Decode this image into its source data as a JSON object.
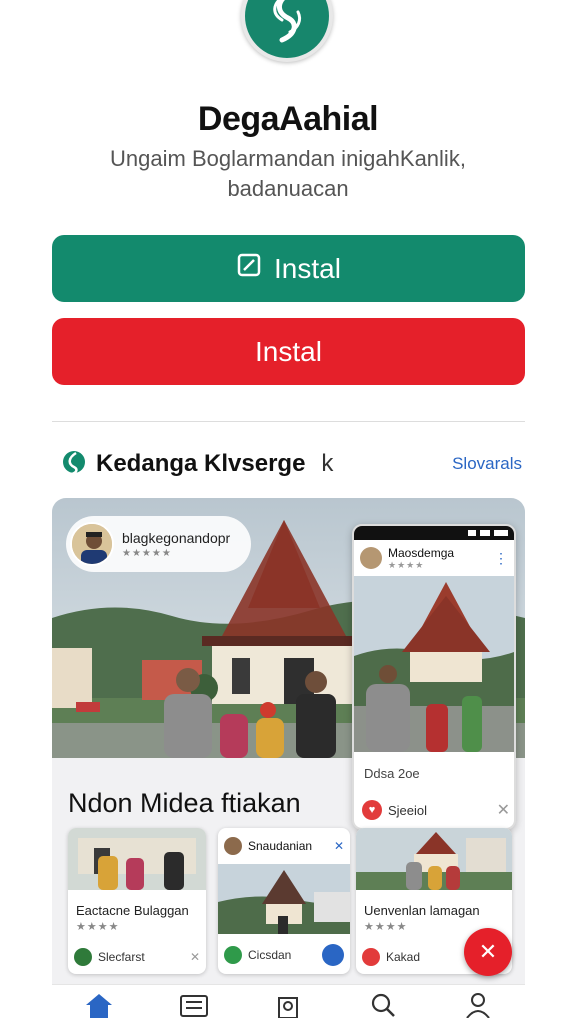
{
  "header": {
    "app_title": "DegaAahial",
    "subtitle_line1": "Ungaim Boglarmandan inigahKanlik,",
    "subtitle_line2": "badanuacan"
  },
  "buttons": {
    "primary_label": "Instal",
    "secondary_label": "Instal"
  },
  "section": {
    "title": "Kedanga Klvserge",
    "mark": "k",
    "link": "Slovarals"
  },
  "gallery": {
    "badge_name": "blagkegonandopr",
    "badge_stars": "★★★★★",
    "phone": {
      "username": "Maosdemga",
      "stars": "★★★★",
      "date": "Ddsa 2oe",
      "action": "Sjeeiol"
    },
    "title": "Ndon Midea ftiakan",
    "cards": [
      {
        "title": "Eactacne Bulaggan",
        "stars": "★★★★",
        "footer": "Slecfarst"
      },
      {
        "title": "Snaudanian",
        "footer": "Cicsdan"
      },
      {
        "title": "Uenvenlan lamagan",
        "stars": "★★★★",
        "footer": "Kakad"
      }
    ]
  },
  "colors": {
    "accent_green": "#138a6d",
    "accent_red": "#e5202a",
    "link_blue": "#2a66c4"
  },
  "icons": [
    "app-logo-icon",
    "edit-square-icon",
    "leaf-icon",
    "close-icon",
    "home-icon",
    "list-icon",
    "bag-icon",
    "search-icon",
    "profile-icon",
    "heart-icon",
    "plus-icon"
  ]
}
